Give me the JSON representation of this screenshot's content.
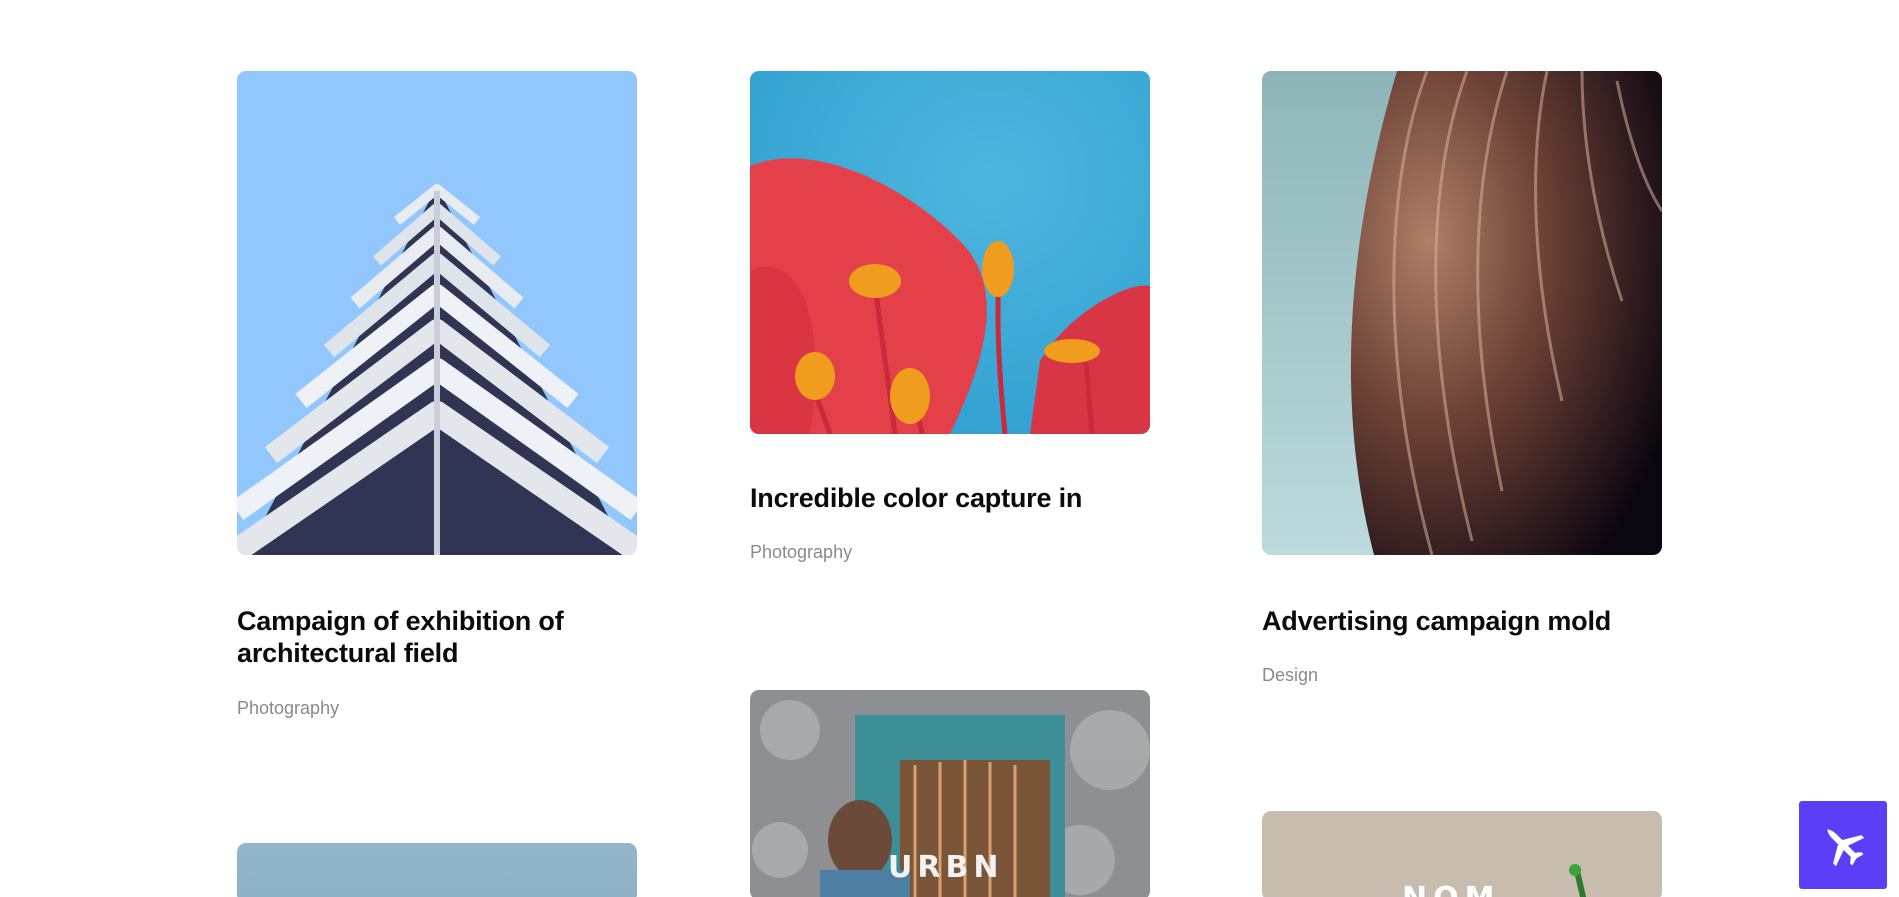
{
  "cards": [
    {
      "title": "Campaign of exhibition of architectural field",
      "category": "Photography"
    },
    {
      "title": "Incredible color capture in",
      "category": "Photography"
    },
    {
      "title": "Advertising campaign mold",
      "category": "Design"
    },
    {
      "title": "",
      "category": ""
    },
    {
      "title": "",
      "category": ""
    },
    {
      "title": "",
      "category": ""
    }
  ],
  "card5_poster_text": "URBN",
  "card6_poster_text": "NOM",
  "fab": {
    "icon": "jet-plane-icon",
    "color": "#5b3ff8"
  }
}
